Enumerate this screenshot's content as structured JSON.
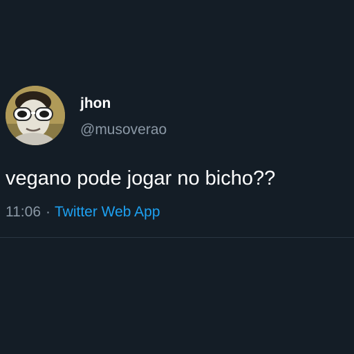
{
  "tweet": {
    "author": {
      "name": "jhon",
      "handle": "@musoverao",
      "avatar_icon": "profile-photo-with-white-sunglasses"
    },
    "text": "vegano pode jogar no bicho??",
    "time": "11:06",
    "separator": "·",
    "source": "Twitter Web App"
  },
  "colors": {
    "background": "#141d26",
    "primary_text": "#ffffff",
    "secondary_text": "#8b98a5",
    "accent": "#1da1f2",
    "divider": "#2a3642"
  }
}
